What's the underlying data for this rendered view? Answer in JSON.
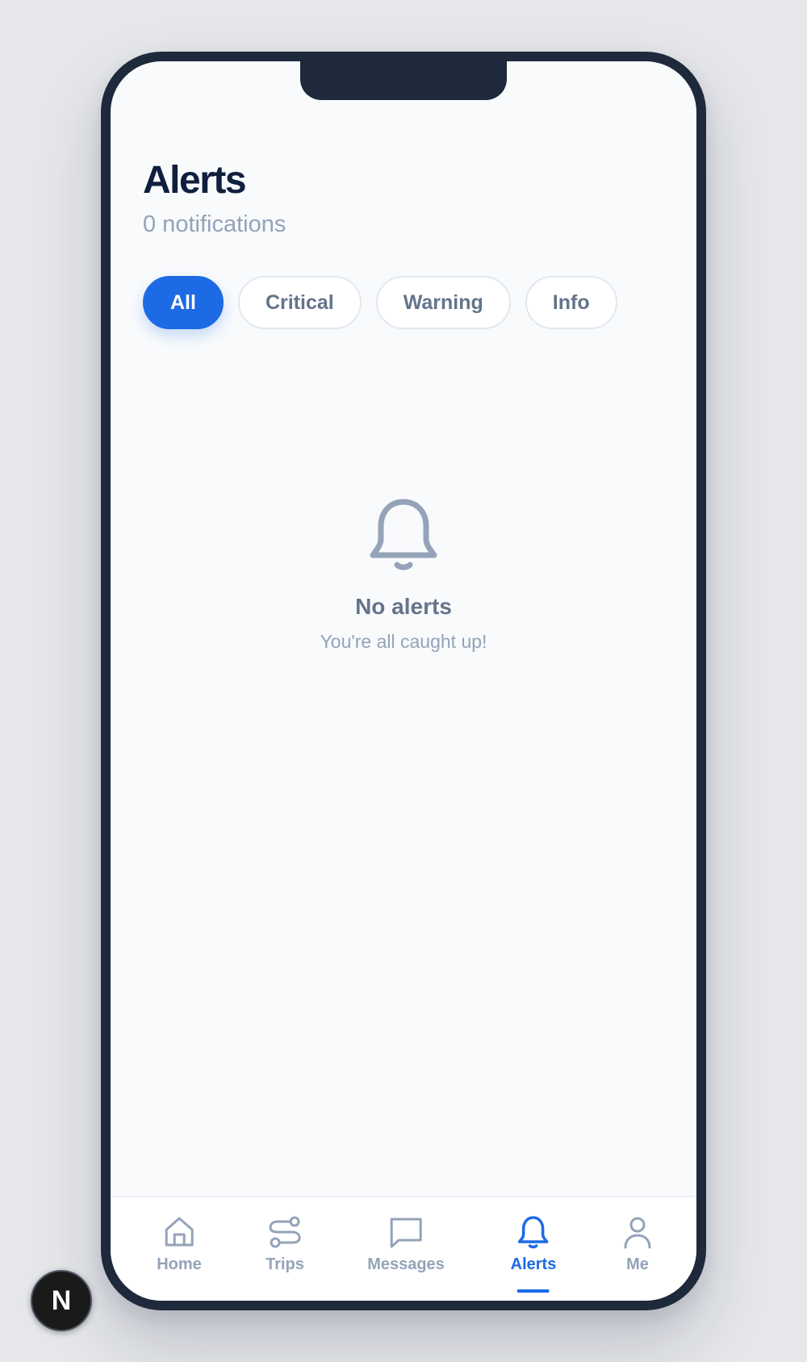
{
  "header": {
    "title": "Alerts",
    "subtitle": "0 notifications"
  },
  "filters": [
    {
      "label": "All",
      "active": true
    },
    {
      "label": "Critical",
      "active": false
    },
    {
      "label": "Warning",
      "active": false
    },
    {
      "label": "Info",
      "active": false
    }
  ],
  "empty_state": {
    "icon": "bell-icon",
    "title": "No alerts",
    "message": "You're all caught up!"
  },
  "tabbar": {
    "items": [
      {
        "label": "Home",
        "icon": "home-icon",
        "active": false
      },
      {
        "label": "Trips",
        "icon": "route-icon",
        "active": false
      },
      {
        "label": "Messages",
        "icon": "chat-icon",
        "active": false
      },
      {
        "label": "Alerts",
        "icon": "bell-icon",
        "active": true
      },
      {
        "label": "Me",
        "icon": "user-icon",
        "active": false
      }
    ]
  },
  "dev_badge": {
    "label": "N",
    "icon": "nextjs-logo-icon"
  },
  "colors": {
    "accent": "#1d6ae5",
    "title": "#0f1f3d",
    "muted": "#94a3b8",
    "frame": "#1e293b",
    "screen_bg": "#f8fafc"
  }
}
